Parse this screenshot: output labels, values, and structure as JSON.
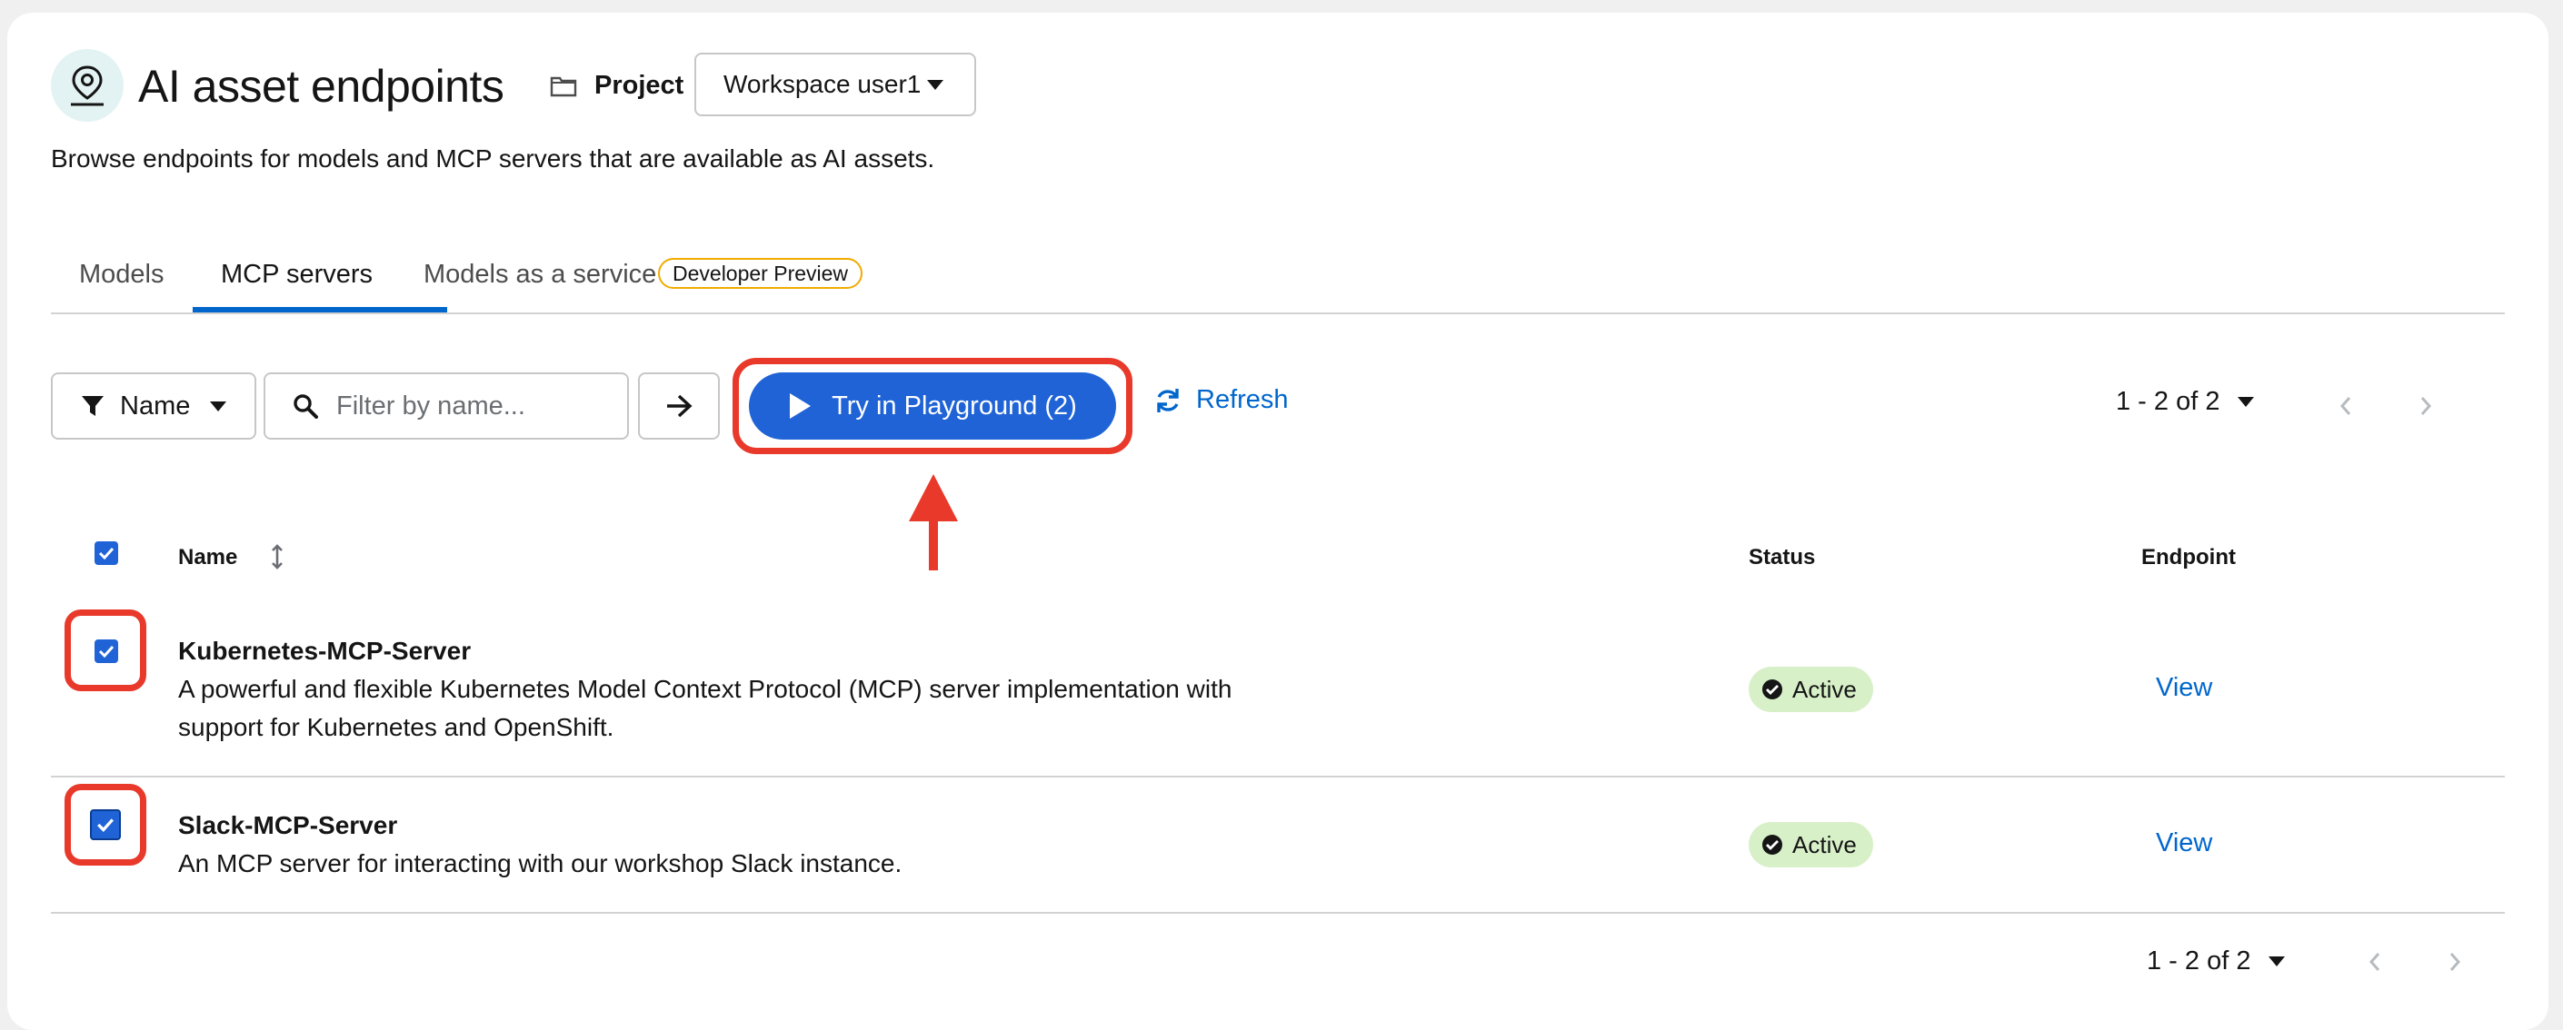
{
  "header": {
    "title": "AI asset endpoints",
    "project_label": "Project",
    "project_value": "Workspace user1",
    "description": "Browse endpoints for models and MCP servers that are available as AI assets."
  },
  "tabs": [
    {
      "label": "Models",
      "active": false
    },
    {
      "label": "MCP servers",
      "active": true
    },
    {
      "label": "Models as a service",
      "active": false,
      "badge": "Developer Preview"
    }
  ],
  "toolbar": {
    "filter_attribute": "Name",
    "search_placeholder": "Filter by name...",
    "playground_label": "Try in Playground (2)",
    "refresh_label": "Refresh",
    "pagination_top": "1 - 2 of 2"
  },
  "table": {
    "columns": {
      "name": "Name",
      "status": "Status",
      "endpoint": "Endpoint"
    },
    "select_all_checked": true,
    "rows": [
      {
        "name": "Kubernetes-MCP-Server",
        "description_line1": "A powerful and flexible Kubernetes Model Context Protocol (MCP) server implementation with",
        "description_line2": "support for Kubernetes and OpenShift.",
        "status": "Active",
        "endpoint_link": "View",
        "checked": true
      },
      {
        "name": "Slack-MCP-Server",
        "description_line1": "An MCP server for interacting with our workshop Slack instance.",
        "status": "Active",
        "endpoint_link": "View",
        "checked": true
      }
    ]
  },
  "pagination_bottom": "1 - 2 of 2",
  "colors": {
    "primary": "#1f63d6",
    "link": "#0066cc",
    "highlight": "#e8392a",
    "status_active_bg": "#d8f0c8",
    "badge_border": "#f0ab00"
  }
}
